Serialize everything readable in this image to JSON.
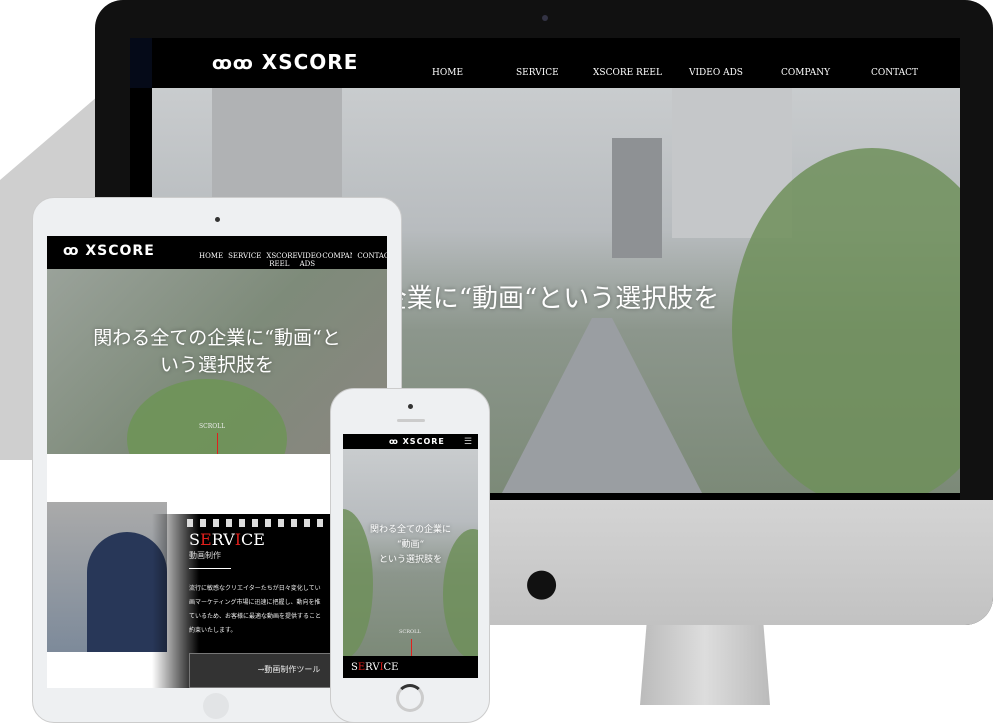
{
  "desktop": {
    "logo": "XSCORE",
    "nav": [
      "HOME",
      "SERVICE",
      "XSCORE REEL",
      "VIDEO ADS",
      "COMPANY",
      "CONTACT"
    ],
    "hero_text": "関わる全ての企業に“動画“という選択肢を"
  },
  "tablet": {
    "logo": "XSCORE",
    "nav": [
      "HOME",
      "SERVICE",
      "XSCORE REEL",
      "VIDEO ADS",
      "COMPANY",
      "CONTACT"
    ],
    "hero_line1": "関わる全ての企業に“動画“と",
    "hero_line2": "いう選択肢を",
    "scroll": "SCROLL",
    "service_title_parts": [
      "S",
      "E",
      "RV",
      "I",
      "CE"
    ],
    "service_subtitle": "動画制作",
    "service_body": [
      "流行に敏感なクリエイターたちが日々変化してい",
      "画マーケティング市場に迅速に把握し、動向を推",
      "ているため、お客様に最適な動画を提供すること",
      "約束いたします。"
    ],
    "service_button": "→動画制作ツール"
  },
  "phone": {
    "logo": "XSCORE",
    "hero_line1": "関わる全ての企業に",
    "hero_line2": "“動画“",
    "hero_line3": "という選択肢を",
    "scroll": "SCROLL",
    "service_title_parts": [
      "S",
      "E",
      "RV",
      "I",
      "CE"
    ]
  },
  "colors": {
    "accent": "#e0201c",
    "bezel": "#111111"
  }
}
